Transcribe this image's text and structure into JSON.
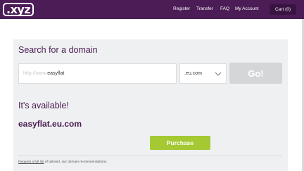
{
  "header": {
    "logo_text": ".xyz",
    "nav": [
      "Register",
      "Transfer",
      "FAQ",
      "My Account"
    ],
    "cart_label": "Cart (0)"
  },
  "search": {
    "title": "Search for a domain",
    "input_prefix": "http://www.",
    "input_value": "easyflat",
    "tld_selected": ".eu.com",
    "go_label": "Go!"
  },
  "result": {
    "status": "It's available!",
    "domain": "easyflat.eu.com",
    "purchase_label": "Purchase"
  },
  "footer": {
    "link_text": "Request a full list",
    "rest_text": " of tailored .xyz domain recommendations."
  },
  "colors": {
    "brand_purple": "#4b1c55",
    "purchase_green": "#a4c933",
    "go_disabled_gray": "#d4d6d8",
    "panel_bg": "#eef0f1"
  }
}
